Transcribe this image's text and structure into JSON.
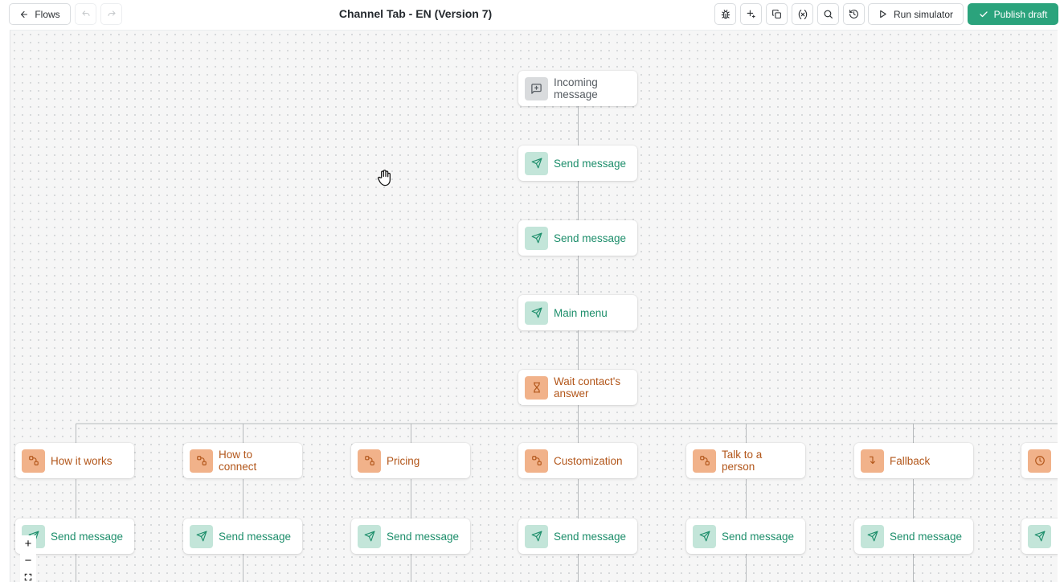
{
  "header": {
    "back_label": "Flows",
    "title": "Channel Tab - EN (Version 7)",
    "run_label": "Run simulator",
    "publish_label": "Publish draft"
  },
  "flow": {
    "trigger": {
      "label": "Incoming message",
      "icon": "message-square-plus-icon"
    },
    "send_1": {
      "label": "Send message",
      "icon": "send-icon"
    },
    "send_2": {
      "label": "Send message",
      "icon": "send-icon"
    },
    "main_menu": {
      "label": "Main menu",
      "icon": "send-icon"
    },
    "wait": {
      "label": "Wait contact's answer",
      "icon": "hourglass-icon"
    },
    "branches": [
      {
        "label": "How it works",
        "icon": "split-icon"
      },
      {
        "label": "How to connect",
        "icon": "split-icon"
      },
      {
        "label": "Pricing",
        "icon": "split-icon"
      },
      {
        "label": "Customization",
        "icon": "split-icon"
      },
      {
        "label": "Talk to a person",
        "icon": "split-icon"
      },
      {
        "label": "Fallback",
        "icon": "corner-down-right-icon"
      },
      {
        "label": "",
        "icon": "clock-icon"
      }
    ],
    "branch_sends": [
      {
        "label": "Send message"
      },
      {
        "label": "Send message"
      },
      {
        "label": "Send message"
      },
      {
        "label": "Send message"
      },
      {
        "label": "Send message"
      },
      {
        "label": "Send message"
      },
      {
        "label": ""
      }
    ]
  },
  "zoom_controls": {
    "zoom_in": "+",
    "zoom_out": "−"
  },
  "colors": {
    "accent_green": "#2ba37c",
    "send_text": "#1d8e6b",
    "send_icon_bg": "#c3e5d9",
    "wait_text": "#b2561a",
    "wait_icon_bg": "#f1b28a"
  }
}
